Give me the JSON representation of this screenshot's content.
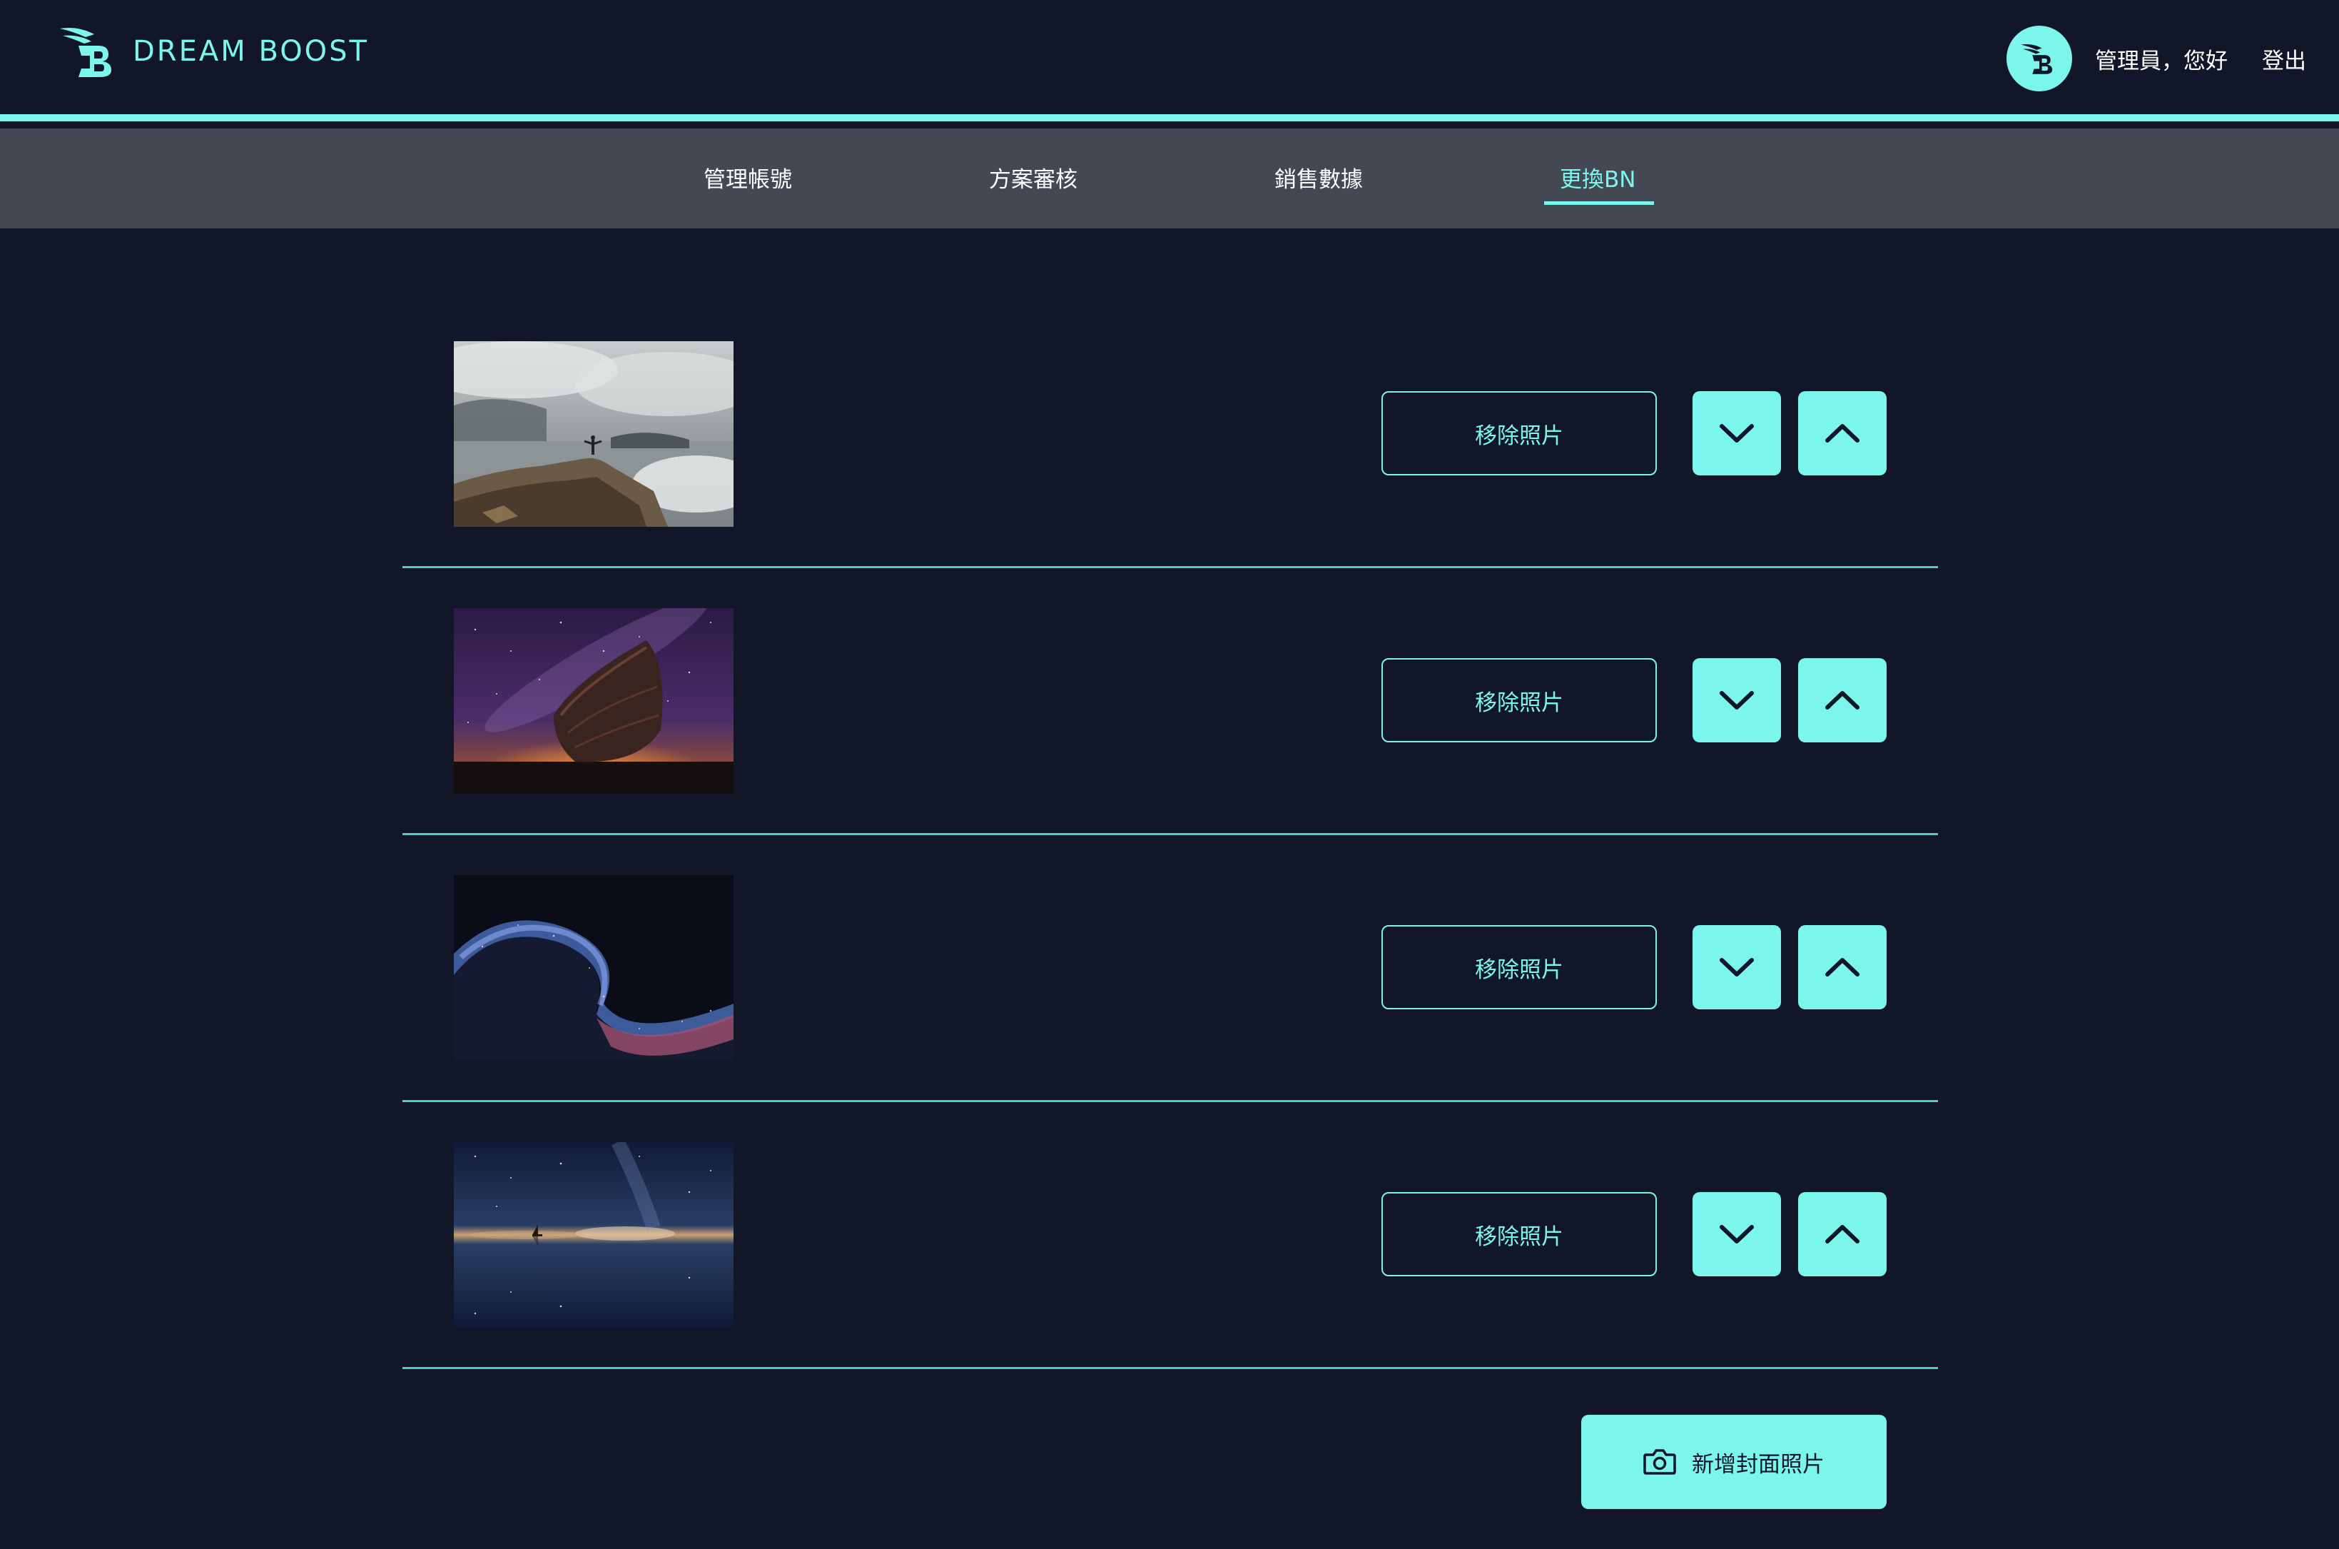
{
  "header": {
    "brand": "DREAM BOOST",
    "greeting": "管理員，您好",
    "logout": "登出",
    "brand_color": "#7cf5ec",
    "background": "#111628"
  },
  "nav": {
    "items": [
      {
        "label": "管理帳號",
        "active": false
      },
      {
        "label": "方案審核",
        "active": false
      },
      {
        "label": "銷售數據",
        "active": false
      },
      {
        "label": "更換BN",
        "active": true
      }
    ]
  },
  "banners": [
    {
      "image": "mountain-summit-photo",
      "remove_label": "移除照片",
      "down_icon": "chevron-down-icon",
      "up_icon": "chevron-up-icon"
    },
    {
      "image": "boat-milky-way-photo",
      "remove_label": "移除照片",
      "down_icon": "chevron-down-icon",
      "up_icon": "chevron-up-icon"
    },
    {
      "image": "galaxy-wave-photo",
      "remove_label": "移除照片",
      "down_icon": "chevron-down-icon",
      "up_icon": "chevron-up-icon"
    },
    {
      "image": "sailboat-starry-reflection-photo",
      "remove_label": "移除照片",
      "down_icon": "chevron-down-icon",
      "up_icon": "chevron-up-icon"
    }
  ],
  "add_button": {
    "label": "新增封面照片",
    "icon": "camera-icon"
  }
}
